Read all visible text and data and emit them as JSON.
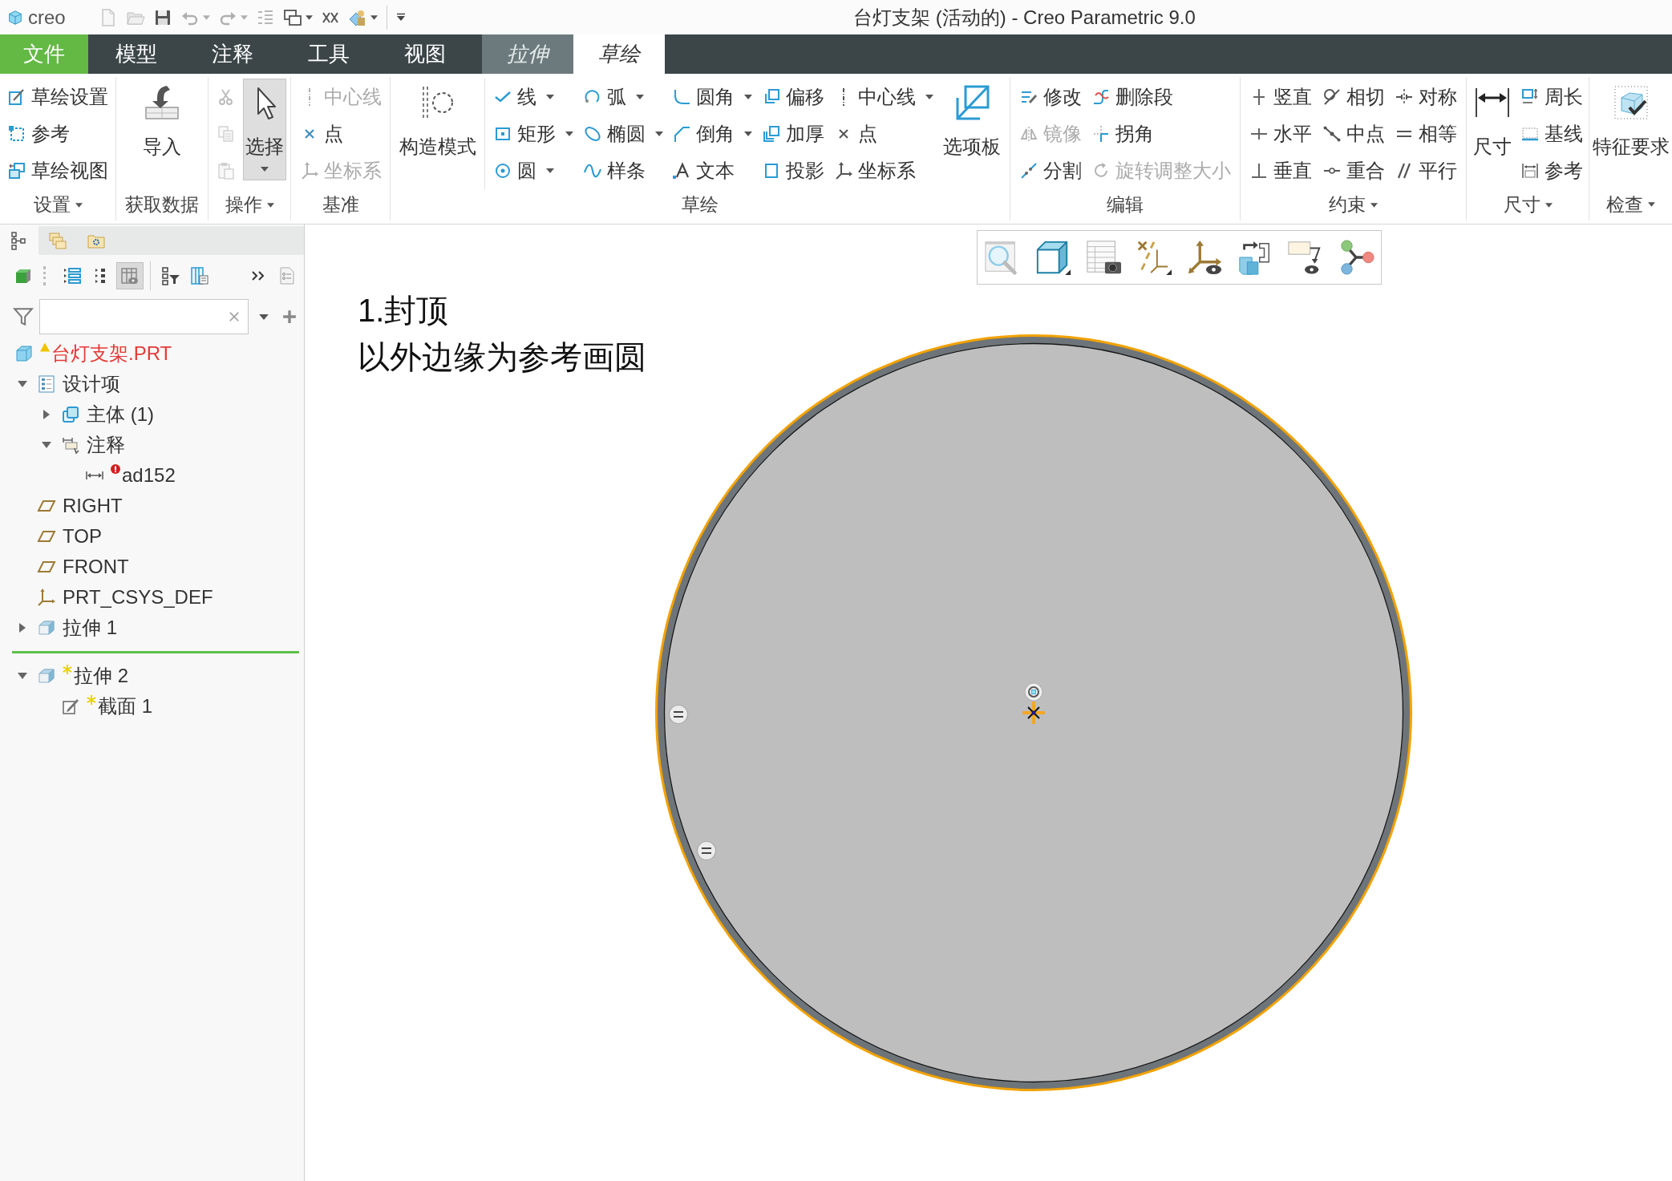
{
  "window": {
    "app_name": "creo",
    "title": "台灯支架 (活动的) - Creo Parametric 9.0"
  },
  "quick_access": [
    {
      "dropdown": false,
      "disabled": true
    },
    {
      "dropdown": false,
      "disabled": true
    },
    {
      "dropdown": false,
      "disabled": false
    },
    {
      "dropdown": true,
      "disabled": true
    },
    {
      "dropdown": true,
      "disabled": true
    },
    {
      "dropdown": false,
      "disabled": true
    },
    {
      "dropdown": true,
      "disabled": false
    },
    {
      "dropdown": false,
      "disabled": false
    },
    {
      "dropdown": true,
      "disabled": false
    }
  ],
  "tabs": [
    {
      "label": "文件",
      "kind": "file",
      "selected": false
    },
    {
      "label": "模型",
      "kind": "main",
      "selected": false
    },
    {
      "label": "注释",
      "kind": "main",
      "selected": false
    },
    {
      "label": "工具",
      "kind": "main",
      "selected": false
    },
    {
      "label": "视图",
      "kind": "main",
      "selected": false
    },
    {
      "label": "拉伸",
      "kind": "context",
      "selected": false
    },
    {
      "label": "草绘",
      "kind": "context",
      "selected": true
    }
  ],
  "ribbon": {
    "groups": [
      {
        "label": "设置",
        "menu": true,
        "parts": [
          {
            "kind": "stack",
            "items": [
              {
                "label": "草绘设置",
                "dropdown": false,
                "disabled": false
              },
              {
                "label": "参考",
                "dropdown": false,
                "disabled": false
              },
              {
                "label": "草绘视图",
                "dropdown": false,
                "disabled": false
              }
            ]
          }
        ]
      },
      {
        "label": "获取数据",
        "menu": false,
        "parts": [
          {
            "kind": "large",
            "label": "导入",
            "dropdown": false,
            "selected": false
          }
        ]
      },
      {
        "label": "操作",
        "menu": true,
        "parts": [
          {
            "kind": "icons",
            "items": [
              {
                "disabled": true
              },
              {
                "disabled": true
              },
              {
                "disabled": true
              }
            ]
          },
          {
            "kind": "large",
            "label": "选择",
            "dropdown": true,
            "selected": true
          }
        ]
      },
      {
        "label": "基准",
        "menu": false,
        "parts": [
          {
            "kind": "stack",
            "items": [
              {
                "label": "中心线",
                "dropdown": false,
                "disabled": true
              },
              {
                "label": "点",
                "dropdown": false,
                "disabled": false
              },
              {
                "label": "坐标系",
                "dropdown": false,
                "disabled": true
              }
            ]
          }
        ]
      },
      {
        "label": "草绘",
        "menu": false,
        "parts": [
          {
            "kind": "large",
            "label": "构造模式",
            "dropdown": false,
            "selected": false
          },
          {
            "kind": "divider"
          },
          {
            "kind": "stack",
            "items": [
              {
                "label": "线",
                "dropdown": true,
                "disabled": false
              },
              {
                "label": "矩形",
                "dropdown": true,
                "disabled": false
              },
              {
                "label": "圆",
                "dropdown": true,
                "disabled": false
              }
            ]
          },
          {
            "kind": "stack",
            "items": [
              {
                "label": "弧",
                "dropdown": true,
                "disabled": false
              },
              {
                "label": "椭圆",
                "dropdown": true,
                "disabled": false
              },
              {
                "label": "样条",
                "dropdown": false,
                "disabled": false
              }
            ]
          },
          {
            "kind": "stack",
            "items": [
              {
                "label": "圆角",
                "dropdown": true,
                "disabled": false
              },
              {
                "label": "倒角",
                "dropdown": true,
                "disabled": false
              },
              {
                "label": "文本",
                "dropdown": false,
                "disabled": false
              }
            ]
          },
          {
            "kind": "stack",
            "items": [
              {
                "label": "偏移",
                "dropdown": false,
                "disabled": false
              },
              {
                "label": "加厚",
                "dropdown": false,
                "disabled": false
              },
              {
                "label": "投影",
                "dropdown": false,
                "disabled": false
              }
            ]
          },
          {
            "kind": "stack",
            "items": [
              {
                "label": "中心线",
                "dropdown": true,
                "disabled": false
              },
              {
                "label": "点",
                "dropdown": false,
                "disabled": false
              },
              {
                "label": "坐标系",
                "dropdown": false,
                "disabled": false
              }
            ]
          },
          {
            "kind": "large",
            "label": "选项板",
            "dropdown": false,
            "selected": false
          }
        ]
      },
      {
        "label": "编辑",
        "menu": false,
        "parts": [
          {
            "kind": "stack",
            "items": [
              {
                "label": "修改",
                "dropdown": false,
                "disabled": false
              },
              {
                "label": "镜像",
                "dropdown": false,
                "disabled": true
              },
              {
                "label": "分割",
                "dropdown": false,
                "disabled": false
              }
            ]
          },
          {
            "kind": "stack",
            "items": [
              {
                "label": "删除段",
                "dropdown": false,
                "disabled": false
              },
              {
                "label": "拐角",
                "dropdown": false,
                "disabled": false
              },
              {
                "label": "旋转调整大小",
                "dropdown": false,
                "disabled": true
              }
            ]
          }
        ]
      },
      {
        "label": "约束",
        "menu": true,
        "parts": [
          {
            "kind": "stack",
            "items": [
              {
                "label": "竖直",
                "dropdown": false,
                "disabled": false
              },
              {
                "label": "水平",
                "dropdown": false,
                "disabled": false
              },
              {
                "label": "垂直",
                "dropdown": false,
                "disabled": false
              }
            ]
          },
          {
            "kind": "stack",
            "items": [
              {
                "label": "相切",
                "dropdown": false,
                "disabled": false
              },
              {
                "label": "中点",
                "dropdown": false,
                "disabled": false
              },
              {
                "label": "重合",
                "dropdown": false,
                "disabled": false
              }
            ]
          },
          {
            "kind": "stack",
            "items": [
              {
                "label": "对称",
                "dropdown": false,
                "disabled": false
              },
              {
                "label": "相等",
                "dropdown": false,
                "disabled": false
              },
              {
                "label": "平行",
                "dropdown": false,
                "disabled": false
              }
            ]
          }
        ]
      },
      {
        "label": "尺寸",
        "menu": true,
        "parts": [
          {
            "kind": "large",
            "label": "尺寸",
            "dropdown": false,
            "selected": false
          },
          {
            "kind": "stack",
            "items": [
              {
                "label": "周长",
                "dropdown": false,
                "disabled": false
              },
              {
                "label": "基线",
                "dropdown": false,
                "disabled": false
              },
              {
                "label": "参考",
                "dropdown": false,
                "disabled": false
              }
            ]
          }
        ]
      },
      {
        "label": "检查",
        "menu": true,
        "parts": [
          {
            "kind": "large",
            "label": "特征要求",
            "dropdown": false,
            "selected": false
          }
        ]
      }
    ]
  },
  "model_tree": {
    "tabs": [
      {
        "selected": true
      },
      {
        "selected": false
      },
      {
        "selected": false
      }
    ],
    "toolbar": [
      {
        "selected": false
      },
      {
        "selected": false
      },
      {
        "selected": false
      },
      {
        "selected": true
      },
      {
        "selected": false
      },
      {
        "selected": false
      },
      {
        "selected": false
      },
      {
        "selected": false
      }
    ],
    "root": {
      "label": "台灯支架.PRT",
      "warning": true
    },
    "items": [
      {
        "kind": "design-items",
        "label": "设计项",
        "expanded": true,
        "new": false,
        "error": false,
        "children": [
          {
            "kind": "body",
            "label": "主体 (1)",
            "expanded": false,
            "new": false,
            "error": false
          },
          {
            "kind": "annotations",
            "label": "注释",
            "expanded": true,
            "new": false,
            "error": false,
            "children": [
              {
                "kind": "dimension",
                "label": "ad152",
                "new": false,
                "error": true
              }
            ]
          }
        ]
      },
      {
        "kind": "plane",
        "label": "RIGHT",
        "new": false,
        "error": false
      },
      {
        "kind": "plane",
        "label": "TOP",
        "new": false,
        "error": false
      },
      {
        "kind": "plane",
        "label": "FRONT",
        "new": false,
        "error": false
      },
      {
        "kind": "csys",
        "label": "PRT_CSYS_DEF",
        "new": false,
        "error": false
      },
      {
        "kind": "extrude",
        "label": "拉伸 1",
        "expanded": false,
        "new": false,
        "error": false
      },
      {
        "kind": "insert-marker"
      },
      {
        "kind": "extrude",
        "label": "拉伸 2",
        "expanded": true,
        "new": true,
        "error": false,
        "children": [
          {
            "kind": "sketch",
            "label": "截面 1",
            "new": true,
            "error": false
          }
        ]
      }
    ]
  },
  "canvas": {
    "note": {
      "title": "1.封顶",
      "text": "以外边缘为参考画圆"
    }
  },
  "sketch": {
    "highlighted": true,
    "constraints": [
      {
        "kind": "equal"
      },
      {
        "kind": "equal"
      }
    ]
  }
}
